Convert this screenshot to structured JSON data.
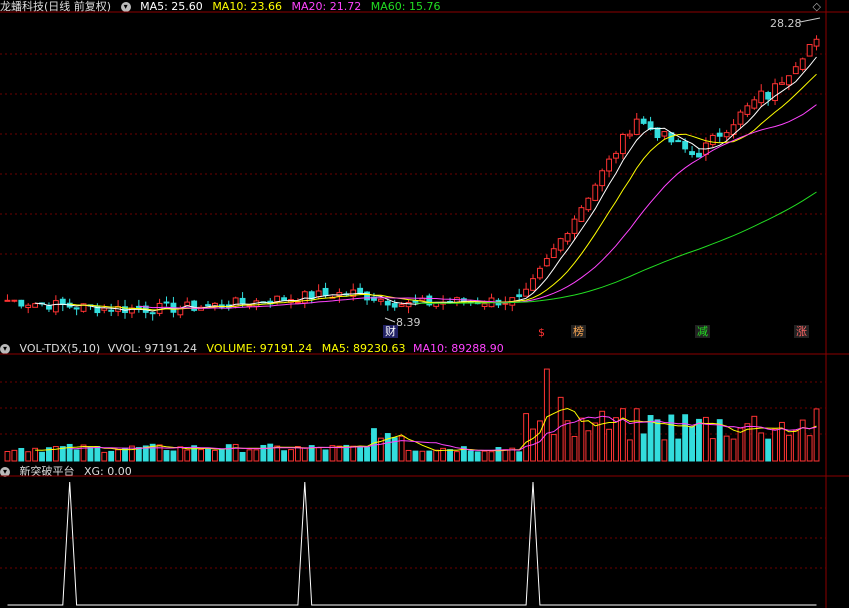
{
  "main_header": {
    "title": "龙蟠科技(日线 前复权)",
    "ma5": "MA5: 25.60",
    "ma10": "MA10: 23.66",
    "ma20": "MA20: 21.72",
    "ma60": "MA60: 15.76",
    "colors": {
      "ma5": "#ffffff",
      "ma10": "#ffff00",
      "ma20": "#ff44ff",
      "ma60": "#22dd22"
    }
  },
  "vol_header": {
    "title": "VOL-TDX(5,10)",
    "vvol": "VVOL: 97191.24",
    "volume": "VOLUME: 97191.24",
    "ma5": "MA5: 89230.63",
    "ma10": "MA10: 89288.90"
  },
  "ind_header": {
    "title": "新突破平台",
    "xg": "XG: 0.00"
  },
  "annotations": {
    "high": "28.28",
    "low": "8.39",
    "tags": [
      "$",
      "榜",
      "减",
      "涨"
    ],
    "cai": "财"
  },
  "chart_data": [
    {
      "type": "candlestick",
      "title": "龙蟠科技(日线 前复权)",
      "ylim": [
        7.5,
        29.5
      ],
      "ohlc": [],
      "note_values": {
        "max": 28.28,
        "min": 8.39
      }
    },
    {
      "type": "bar",
      "title": "VOL-TDX(5,10)",
      "series": [
        {
          "name": "VOLUME",
          "values": []
        }
      ],
      "ylim": [
        0,
        140000
      ]
    },
    {
      "type": "line",
      "title": "新突破平台",
      "series": [
        {
          "name": "XG",
          "values": []
        }
      ],
      "signal_bars": [
        32,
        160,
        278
      ]
    }
  ]
}
